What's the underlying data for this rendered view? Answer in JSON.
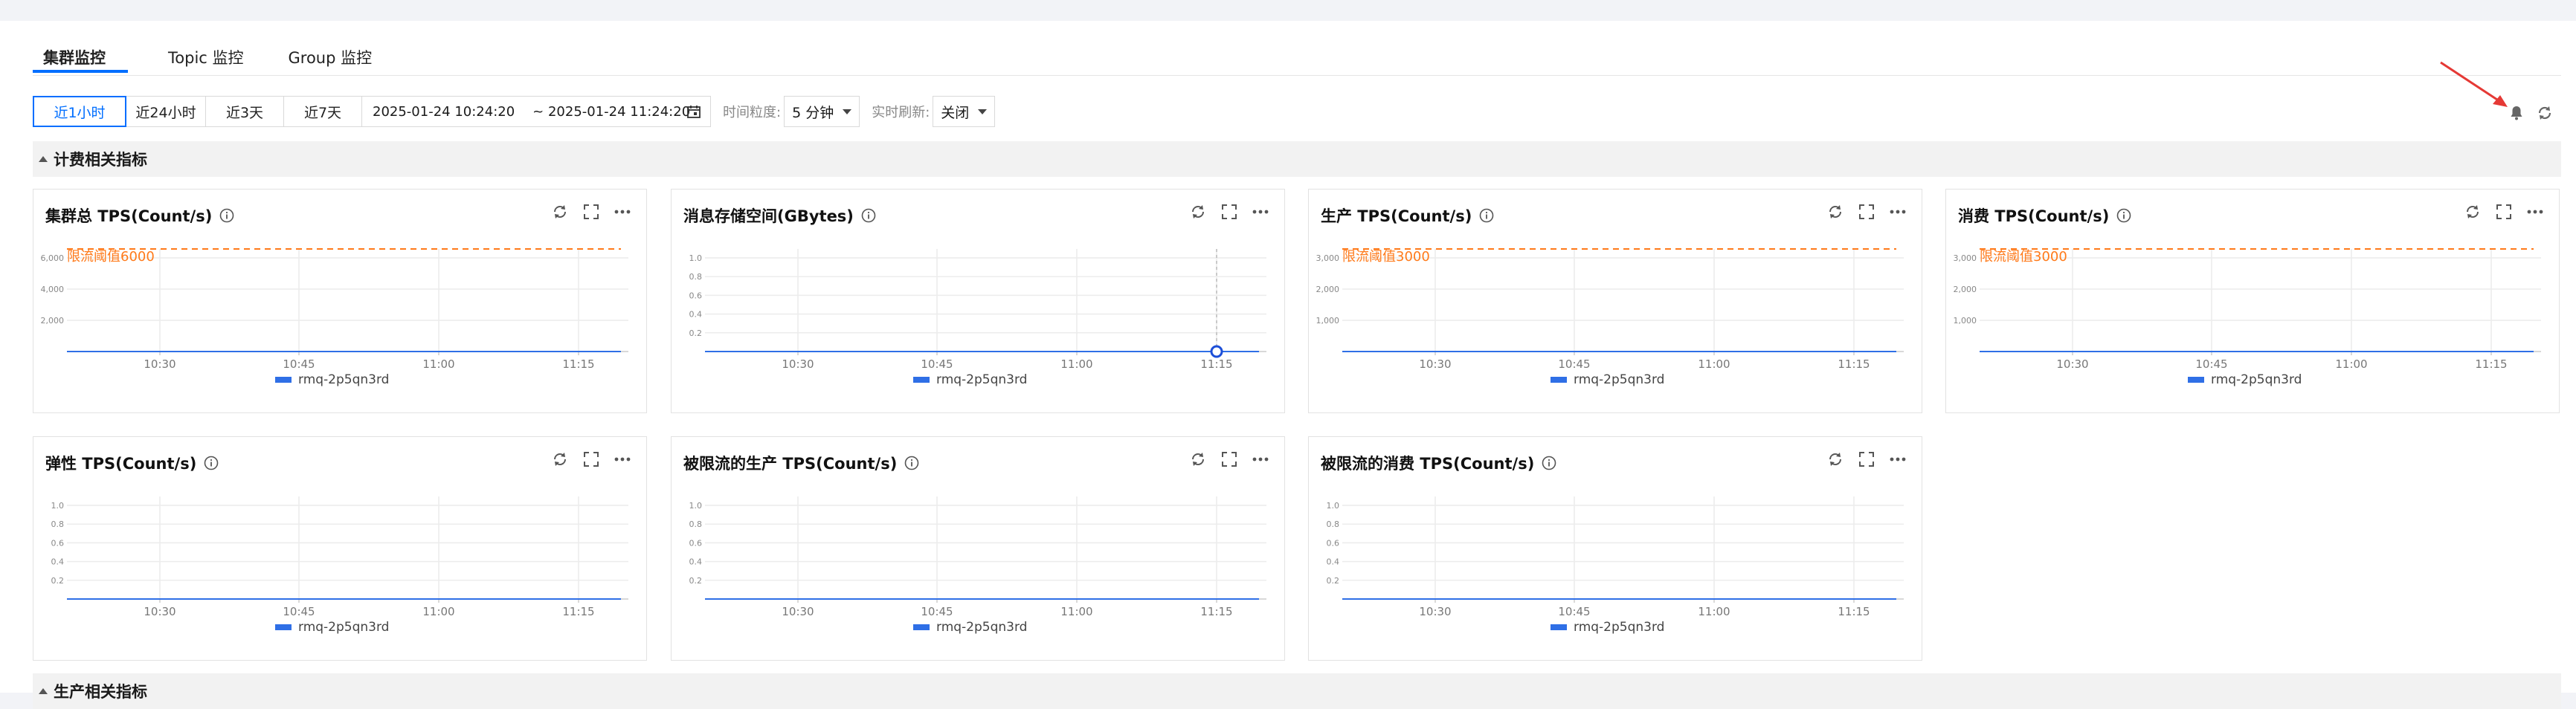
{
  "tabs": [
    {
      "label": "集群监控",
      "active": true
    },
    {
      "label": "Topic 监控",
      "active": false
    },
    {
      "label": "Group 监控",
      "active": false
    }
  ],
  "toolbar": {
    "ranges": [
      {
        "label": "近1小时",
        "active": true
      },
      {
        "label": "近24小时",
        "active": false
      },
      {
        "label": "近3天",
        "active": false
      },
      {
        "label": "近7天",
        "active": false
      }
    ],
    "date_start": "2025-01-24 10:24:20",
    "date_end": "~ 2025-01-24 11:24:20",
    "granularity_label": "时间粒度:",
    "granularity_value": "5 分钟",
    "refresh_label": "实时刷新:",
    "refresh_value": "关闭"
  },
  "sections": [
    {
      "title": "计费相关指标"
    },
    {
      "title": "生产相关指标"
    }
  ],
  "colors": {
    "accent": "#006eff",
    "series": "#2f6fe6",
    "threshold": "#ff7a1a",
    "alert_arrow": "#e53935"
  },
  "icons": [
    "bell-icon",
    "refresh-icon",
    "calendar-icon",
    "info-icon",
    "fullscreen-icon",
    "more-icon"
  ],
  "chart_data": [
    {
      "type": "line",
      "title": "集群总 TPS(Count/s)",
      "x": [
        "10:30",
        "10:45",
        "11:00",
        "11:15"
      ],
      "yticks": [
        "2,000",
        "4,000",
        "6,000"
      ],
      "ylim": [
        0,
        6000
      ],
      "threshold": {
        "value": 6000,
        "label": "限流阈值6000"
      },
      "series": [
        {
          "name": "rmq-2p5qn3rd",
          "values": [
            0,
            0,
            0,
            0
          ]
        }
      ],
      "marker": false
    },
    {
      "type": "line",
      "title": "消息存储空间(GBytes)",
      "x": [
        "10:30",
        "10:45",
        "11:00",
        "11:15"
      ],
      "yticks": [
        "0.2",
        "0.4",
        "0.6",
        "0.8",
        "1.0"
      ],
      "ylim": [
        0,
        1
      ],
      "threshold": null,
      "series": [
        {
          "name": "rmq-2p5qn3rd",
          "values": [
            0,
            0,
            0,
            0
          ]
        }
      ],
      "marker": true
    },
    {
      "type": "line",
      "title": "生产 TPS(Count/s)",
      "x": [
        "10:30",
        "10:45",
        "11:00",
        "11:15"
      ],
      "yticks": [
        "1,000",
        "2,000",
        "3,000"
      ],
      "ylim": [
        0,
        3000
      ],
      "threshold": {
        "value": 3000,
        "label": "限流阈值3000"
      },
      "series": [
        {
          "name": "rmq-2p5qn3rd",
          "values": [
            0,
            0,
            0,
            0
          ]
        }
      ],
      "marker": false
    },
    {
      "type": "line",
      "title": "消费 TPS(Count/s)",
      "x": [
        "10:30",
        "10:45",
        "11:00",
        "11:15"
      ],
      "yticks": [
        "1,000",
        "2,000",
        "3,000"
      ],
      "ylim": [
        0,
        3000
      ],
      "threshold": {
        "value": 3000,
        "label": "限流阈值3000"
      },
      "series": [
        {
          "name": "rmq-2p5qn3rd",
          "values": [
            0,
            0,
            0,
            0
          ]
        }
      ],
      "marker": false
    },
    {
      "type": "line",
      "title": "弹性 TPS(Count/s)",
      "x": [
        "10:30",
        "10:45",
        "11:00",
        "11:15"
      ],
      "yticks": [
        "0.2",
        "0.4",
        "0.6",
        "0.8",
        "1.0"
      ],
      "ylim": [
        0,
        1
      ],
      "threshold": null,
      "series": [
        {
          "name": "rmq-2p5qn3rd",
          "values": [
            0,
            0,
            0,
            0
          ]
        }
      ],
      "marker": false
    },
    {
      "type": "line",
      "title": "被限流的生产 TPS(Count/s)",
      "x": [
        "10:30",
        "10:45",
        "11:00",
        "11:15"
      ],
      "yticks": [
        "0.2",
        "0.4",
        "0.6",
        "0.8",
        "1.0"
      ],
      "ylim": [
        0,
        1
      ],
      "threshold": null,
      "series": [
        {
          "name": "rmq-2p5qn3rd",
          "values": [
            0,
            0,
            0,
            0
          ]
        }
      ],
      "marker": false
    },
    {
      "type": "line",
      "title": "被限流的消费 TPS(Count/s)",
      "x": [
        "10:30",
        "10:45",
        "11:00",
        "11:15"
      ],
      "yticks": [
        "0.2",
        "0.4",
        "0.6",
        "0.8",
        "1.0"
      ],
      "ylim": [
        0,
        1
      ],
      "threshold": null,
      "series": [
        {
          "name": "rmq-2p5qn3rd",
          "values": [
            0,
            0,
            0,
            0
          ]
        }
      ],
      "marker": false
    }
  ]
}
